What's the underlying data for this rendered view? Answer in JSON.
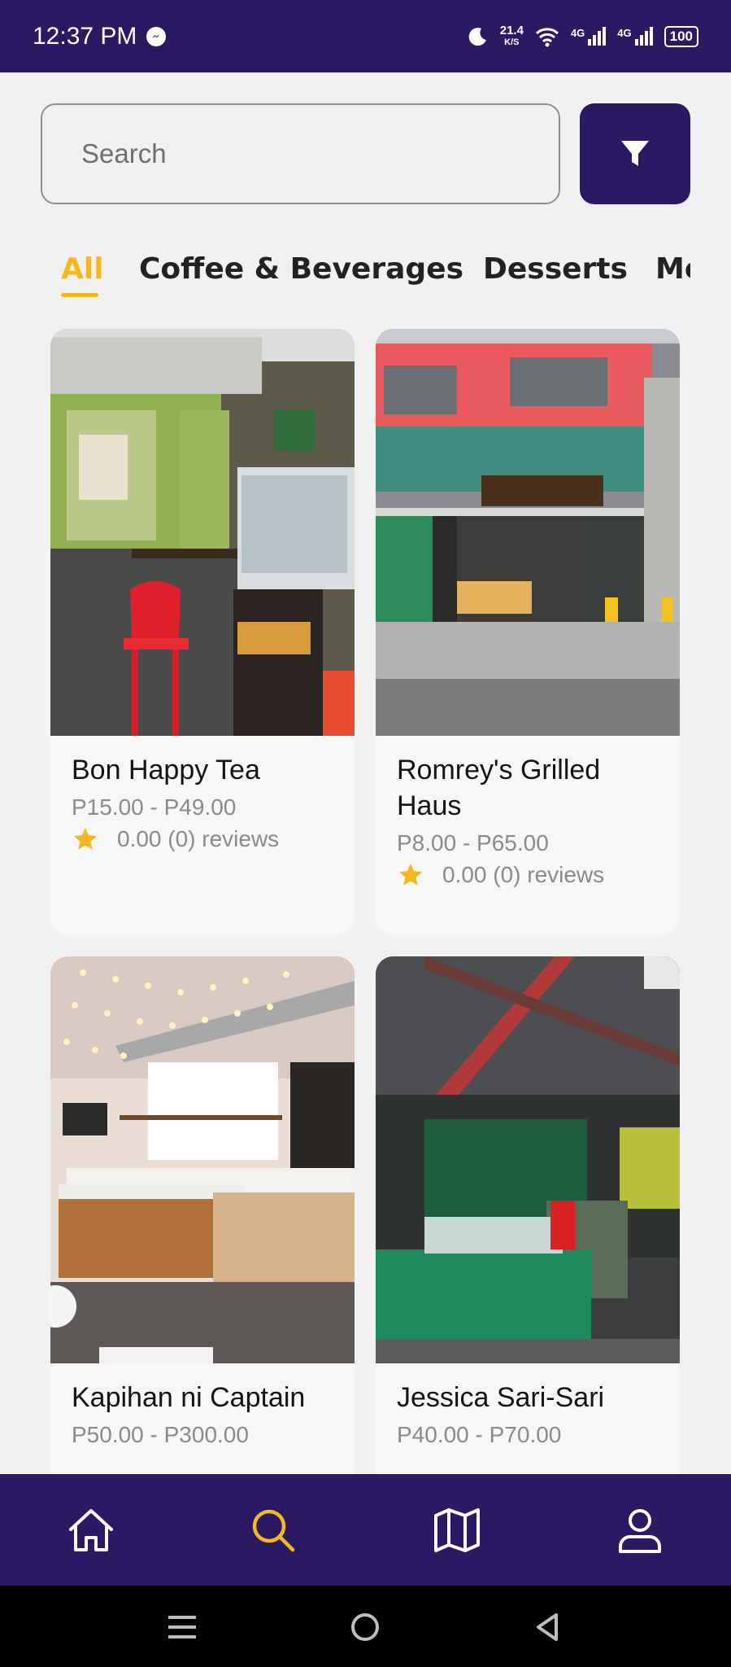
{
  "status_bar": {
    "time": "12:37 PM",
    "net_speed_value": "21.4",
    "net_speed_unit": "K/S",
    "signal1_label": "4G",
    "signal2_label": "4G",
    "battery": "100",
    "icons": [
      "messenger-icon",
      "moon-icon",
      "wifi-icon",
      "signal-icon",
      "battery-icon"
    ]
  },
  "search": {
    "placeholder": "Search"
  },
  "filter": {
    "icon": "filter-funnel-icon"
  },
  "tabs": [
    {
      "label": "All",
      "active": true
    },
    {
      "label": "Coffee & Beverages",
      "active": false
    },
    {
      "label": "Desserts",
      "active": false
    },
    {
      "label": "Me",
      "active": false
    }
  ],
  "stores": [
    {
      "name": "Bon Happy Tea",
      "price_range": "P15.00 - P49.00",
      "rating": "0.00 (0) reviews"
    },
    {
      "name": "Romrey's Grilled Haus",
      "price_range": "P8.00 - P65.00",
      "rating": "0.00 (0) reviews"
    },
    {
      "name": "Kapihan ni Captain",
      "price_range": "P50.00 - P300.00",
      "rating": ""
    },
    {
      "name": "Jessica Sari-Sari",
      "price_range": "P40.00 - P70.00",
      "rating": ""
    }
  ],
  "bottom_nav": [
    {
      "icon": "home-icon",
      "active": false
    },
    {
      "icon": "search-icon",
      "active": true
    },
    {
      "icon": "map-icon",
      "active": false
    },
    {
      "icon": "profile-icon",
      "active": false
    }
  ],
  "colors": {
    "brand": "#2b1a63",
    "accent": "#f5b820",
    "background": "#f1f1f1"
  }
}
